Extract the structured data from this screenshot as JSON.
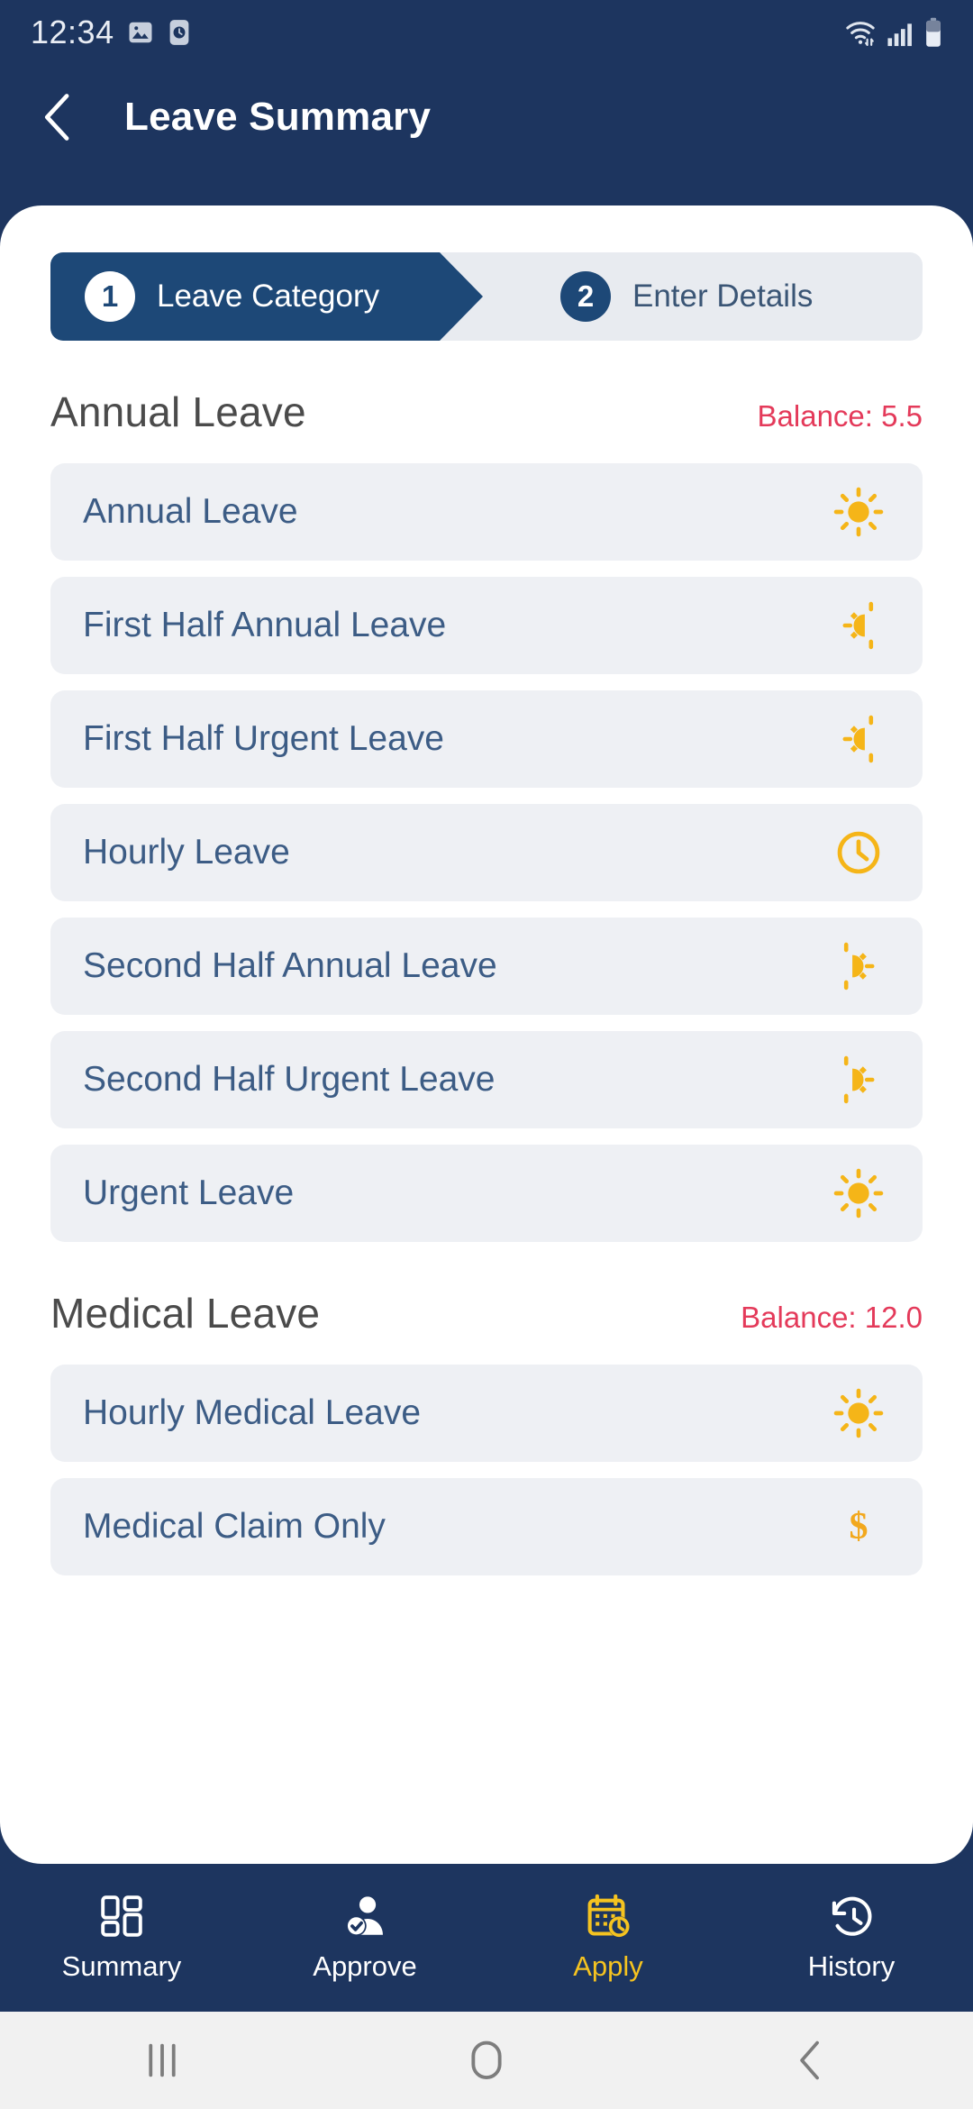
{
  "statusbar": {
    "time": "12:34",
    "left_icons": [
      "image-icon",
      "clock-widget-icon"
    ],
    "right_icons": [
      "wifi-icon",
      "cellular-signal-icon",
      "battery-icon"
    ]
  },
  "appbar": {
    "back_icon": "chevron-left-icon",
    "title": "Leave Summary"
  },
  "colors": {
    "header_navy": "#1d355f",
    "step_active": "#1d4877",
    "step_track": "#e8ebf0",
    "row_bg": "#eef0f4",
    "row_text": "#3c5c85",
    "balance_red": "#e43a5a",
    "icon_amber": "#f2a81d",
    "nav_active": "#f5c320"
  },
  "stepper": {
    "steps": [
      {
        "number": "1",
        "label": "Leave Category",
        "active": true
      },
      {
        "number": "2",
        "label": "Enter Details",
        "active": false
      }
    ]
  },
  "groups": [
    {
      "title": "Annual Leave",
      "balance_label": "Balance: 5.5",
      "items": [
        {
          "label": "Annual Leave",
          "icon": "sun-full-icon"
        },
        {
          "label": "First Half Annual Leave",
          "icon": "sun-first-half-icon"
        },
        {
          "label": "First Half Urgent Leave",
          "icon": "sun-first-half-icon"
        },
        {
          "label": "Hourly Leave",
          "icon": "clock-icon"
        },
        {
          "label": "Second Half Annual Leave",
          "icon": "sun-second-half-icon"
        },
        {
          "label": "Second Half Urgent Leave",
          "icon": "sun-second-half-icon"
        },
        {
          "label": "Urgent Leave",
          "icon": "sun-full-icon"
        }
      ]
    },
    {
      "title": "Medical Leave",
      "balance_label": "Balance: 12.0",
      "items": [
        {
          "label": "Hourly Medical Leave",
          "icon": "sun-full-icon"
        },
        {
          "label": "Medical Claim Only",
          "icon": "dollar-icon"
        }
      ]
    }
  ],
  "bottomnav": {
    "items": [
      {
        "label": "Summary",
        "icon": "dashboard-grid-icon",
        "active": false
      },
      {
        "label": "Approve",
        "icon": "user-check-icon",
        "active": false
      },
      {
        "label": "Apply",
        "icon": "calendar-clock-icon",
        "active": true
      },
      {
        "label": "History",
        "icon": "clock-history-icon",
        "active": false
      }
    ]
  },
  "sysbar": {
    "items": [
      {
        "icon": "recents-icon"
      },
      {
        "icon": "home-icon"
      },
      {
        "icon": "back-icon"
      }
    ]
  }
}
